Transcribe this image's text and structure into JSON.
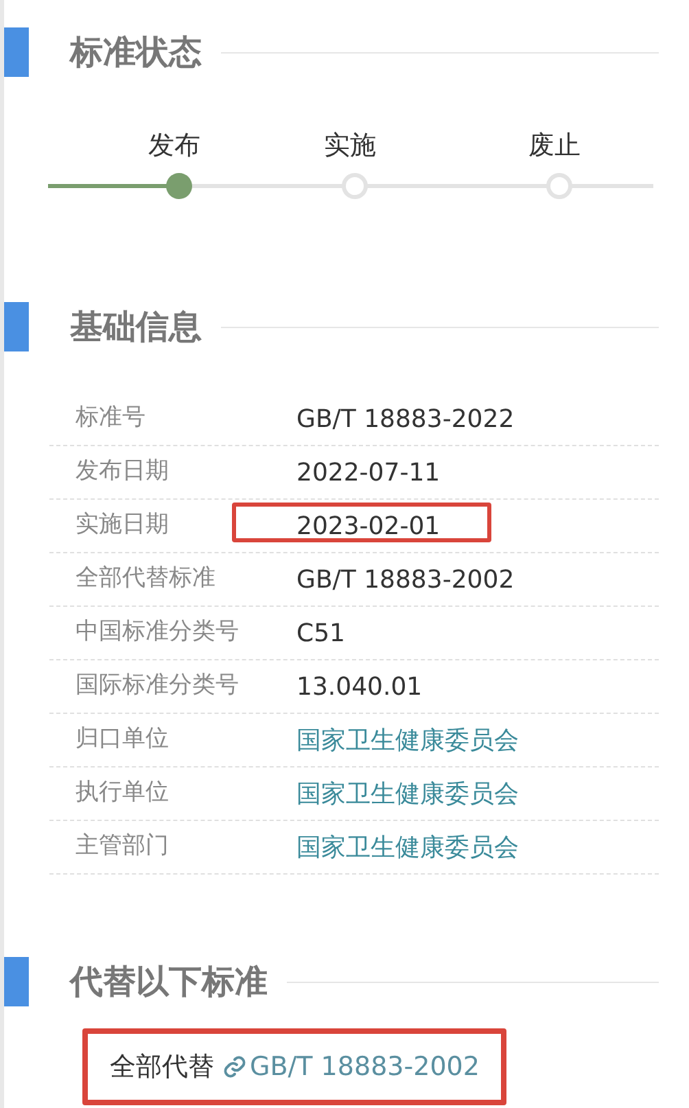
{
  "status_section": {
    "title": "标准状态",
    "steps": [
      {
        "label": "发布",
        "reached": true
      },
      {
        "label": "实施",
        "reached": false
      },
      {
        "label": "废止",
        "reached": false
      }
    ]
  },
  "info_section": {
    "title": "基础信息",
    "rows": [
      {
        "label": "标准号",
        "value": "GB/T 18883-2022",
        "kind": "text",
        "highlighted": false
      },
      {
        "label": "发布日期",
        "value": "2022-07-11",
        "kind": "text",
        "highlighted": false
      },
      {
        "label": "实施日期",
        "value": "2023-02-01",
        "kind": "text",
        "highlighted": true
      },
      {
        "label": "全部代替标准",
        "value": "GB/T 18883-2002",
        "kind": "text",
        "highlighted": false
      },
      {
        "label": "中国标准分类号",
        "value": "C51",
        "kind": "text",
        "highlighted": false
      },
      {
        "label": "国际标准分类号",
        "value": "13.040.01",
        "kind": "text",
        "highlighted": false
      },
      {
        "label": "归口单位",
        "value": "国家卫生健康委员会",
        "kind": "link",
        "highlighted": false
      },
      {
        "label": "执行单位",
        "value": "国家卫生健康委员会",
        "kind": "link",
        "highlighted": false
      },
      {
        "label": "主管部门",
        "value": "国家卫生健康委员会",
        "kind": "link",
        "highlighted": false
      }
    ]
  },
  "replace_section": {
    "title": "代替以下标准",
    "items": [
      {
        "label": "全部代替",
        "link": "GB/T 18883-2002",
        "highlighted": true
      }
    ]
  }
}
